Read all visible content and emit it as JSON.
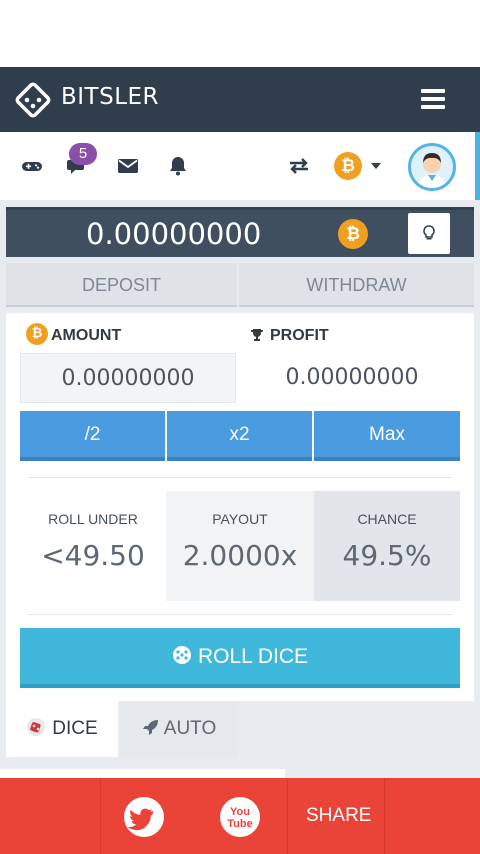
{
  "navbar": {
    "brand": "BITSLER",
    "logo_icon": "dice-logo-icon",
    "menu_icon": "hamburger-menu-icon"
  },
  "toolbar": {
    "icons": [
      "gamepad-icon",
      "chat-icon",
      "mail-icon",
      "bell-icon",
      "swap-icon",
      "bitcoin-icon",
      "caret-down-icon",
      "avatar"
    ],
    "chat_badge": "5",
    "currency_symbol": "₿"
  },
  "balance": {
    "value": "0.00000000",
    "coin_symbol": "₿",
    "hint_icon": "lightbulb-icon"
  },
  "actions": {
    "deposit": "DEPOSIT",
    "withdraw": "WITHDRAW"
  },
  "bet": {
    "amount_label": "AMOUNT",
    "amount_value": "0.00000000",
    "profit_label": "PROFIT",
    "profit_value": "0.00000000",
    "half": "/2",
    "double": "x2",
    "max": "Max"
  },
  "stats": {
    "roll_under_label": "ROLL UNDER",
    "roll_under_value": "<49.50",
    "payout_label": "PAYOUT",
    "payout_value": "2.0000x",
    "chance_label": "CHANCE",
    "chance_value": "49.5%"
  },
  "roll_button": "ROLL DICE",
  "tabs": [
    {
      "label": "DICE",
      "icon": "dice-icon",
      "active": true
    },
    {
      "label": "AUTO",
      "icon": "rocket-icon",
      "active": false
    }
  ],
  "share": {
    "label": "SHARE",
    "icons": [
      "twitter-icon",
      "youtube-icon"
    ]
  },
  "colors": {
    "navbar": "#2f3d4c",
    "accent_blue": "#4a9be0",
    "roll_button": "#3fb8dc",
    "share_bar": "#ea4337",
    "bitcoin": "#f0a020",
    "badge": "#8a4fa6"
  }
}
